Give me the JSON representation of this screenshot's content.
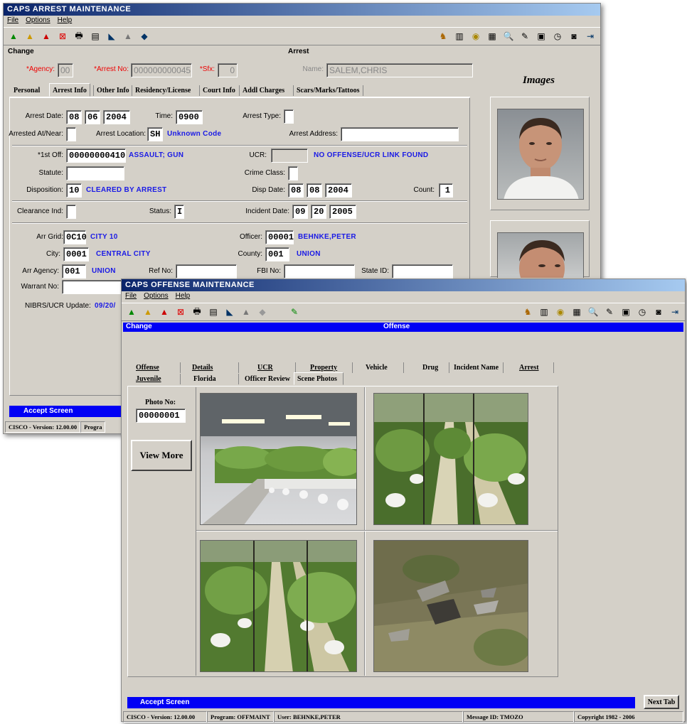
{
  "arrest": {
    "title": "CAPS ARREST MAINTENANCE",
    "menu": [
      "File",
      "Options",
      "Help"
    ],
    "mode": "Change",
    "section": "Arrest",
    "agency_label": "*Agency:",
    "agency": "00",
    "arrest_no_label": "*Arrest No:",
    "arrest_no": "000000000045",
    "sfx_label": "*Sfx:",
    "sfx": "0",
    "name_label": "Name:",
    "name": "SALEM,CHRIS",
    "images_title": "Images",
    "tabs": [
      "Personal",
      "Arrest Info",
      "Other Info",
      "Residency/License",
      "Court Info",
      "Addl Charges",
      "Scars/Marks/Tattoos"
    ],
    "arrest_date_label": "Arrest Date:",
    "arrest_date": [
      "08",
      "06",
      "2004"
    ],
    "time_label": "Time:",
    "time": "0900",
    "arrest_type_label": "Arrest Type:",
    "arrested_at_label": "Arrested At/Near:",
    "arrest_location_label": "Arrest Location:",
    "arrest_location": "SH",
    "arrest_location_desc": "Unknown Code",
    "arrest_address_label": "Arrest Address:",
    "off1_label": "*1st Off:",
    "off1": "00000000410",
    "off1_desc": "ASSAULT; GUN",
    "ucr_label": "UCR:",
    "ucr_desc": "NO OFFENSE/UCR LINK FOUND",
    "statute_label": "Statute:",
    "crime_class_label": "Crime Class:",
    "disposition_label": "Disposition:",
    "disposition": "10",
    "disposition_desc": "CLEARED BY ARREST",
    "disp_date_label": "Disp Date:",
    "disp_date": [
      "08",
      "08",
      "2004"
    ],
    "count_label": "Count:",
    "count": "1",
    "clearance_label": "Clearance Ind:",
    "status_label": "Status:",
    "status": "I",
    "incident_date_label": "Incident Date:",
    "incident_date": [
      "09",
      "20",
      "2005"
    ],
    "arr_grid_label": "Arr Grid:",
    "arr_grid": "0C10",
    "arr_grid_desc": "CITY 10",
    "officer_label": "Officer:",
    "officer": "00001",
    "officer_desc": "BEHNKE,PETER",
    "city_label": "City:",
    "city": "0001",
    "city_desc": "CENTRAL CITY",
    "county_label": "County:",
    "county": "001",
    "county_desc": "UNION",
    "arr_agency_label": "Arr Agency:",
    "arr_agency": "001",
    "arr_agency_desc": "UNION",
    "ref_no_label": "Ref No:",
    "fbi_no_label": "FBI No:",
    "state_id_label": "State ID:",
    "warrant_label": "Warrant No:",
    "nibrs_label": "NIBRS/UCR Update:",
    "nibrs_value": "09/20/",
    "accept": "Accept Screen",
    "footer_version": "CISCO - Version: 12.00.00",
    "footer_program": "Progra"
  },
  "offense": {
    "title": "CAPS OFFENSE MAINTENANCE",
    "menu": [
      "File",
      "Options",
      "Help"
    ],
    "mode": "Change",
    "section": "Offense",
    "tabs_row1": [
      "Offense",
      "Details",
      "UCR",
      "Property",
      "Vehicle",
      "Drug",
      "Incident Name",
      "Arrest"
    ],
    "tabs_row2": [
      "Juvenile",
      "Florida",
      "Officer Review",
      "Scene Photos"
    ],
    "photo_no_label": "Photo No:",
    "photo_no": "00000001",
    "view_more": "View More",
    "accept": "Accept Screen",
    "next_tab": "Next Tab",
    "footer": [
      "CISCO - Version: 12.00.00",
      "Program: OFFMAINT",
      "User: BEHNKE,PETER",
      "Message ID: TMOZO",
      "Copyright 1982 - 2006"
    ]
  },
  "colors": {
    "accent": "#0000f5",
    "desc_text": "#1a1ae6",
    "required_label": "#ee0000",
    "titlebar": "#0a246a"
  }
}
